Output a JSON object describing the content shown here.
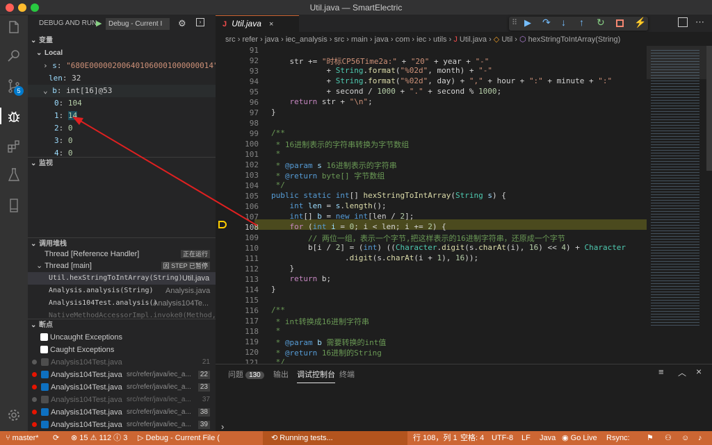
{
  "window": {
    "title": "Util.java — SmartElectric"
  },
  "debug_panel": {
    "title": "DEBUG AND RUN",
    "config": "Debug - Current I"
  },
  "variables": {
    "section": "变量",
    "scope": "Local",
    "items": [
      {
        "name": "s",
        "value": "\"680E000002006401060001000000014\""
      },
      {
        "name": "len",
        "value": "32"
      },
      {
        "name": "b",
        "value": "int[16]@53"
      }
    ],
    "array": [
      {
        "index": "0",
        "value": "104"
      },
      {
        "index": "1",
        "value": "14"
      },
      {
        "index": "2",
        "value": "0"
      },
      {
        "index": "3",
        "value": "0"
      },
      {
        "index": "4",
        "value": "0"
      }
    ]
  },
  "watch": {
    "section": "监视"
  },
  "callstack": {
    "section": "调用堆栈",
    "threads": [
      {
        "name": "Thread [Reference Handler]",
        "status": "正在运行"
      },
      {
        "name": "Thread [main]",
        "status": "因 STEP 已暂停"
      }
    ],
    "frames": [
      {
        "fn": "Util.hexStringToIntArray(String)",
        "file": "Util.java"
      },
      {
        "fn": "Analysis.analysis(String)",
        "file": "Analysis.java"
      },
      {
        "fn": "Analysis104Test.analysis()",
        "file": "Analysis104Te..."
      },
      {
        "fn": "NativeMethodAccessorImpl.invoke0(Method,Obje",
        "file": ""
      }
    ]
  },
  "breakpoints": {
    "section": "断点",
    "exceptions": [
      "Uncaught Exceptions",
      "Caught Exceptions"
    ],
    "items": [
      {
        "file": "Analysis104Test.java",
        "path": "",
        "line": "21",
        "enabled": false
      },
      {
        "file": "Analysis104Test.java",
        "path": "src/refer/java/iec_a...",
        "line": "22",
        "enabled": true
      },
      {
        "file": "Analysis104Test.java",
        "path": "src/refer/java/iec_a...",
        "line": "23",
        "enabled": true
      },
      {
        "file": "Analysis104Test.java",
        "path": "src/refer/java/iec_a...",
        "line": "37",
        "enabled": false
      },
      {
        "file": "Analysis104Test.java",
        "path": "src/refer/java/iec_a...",
        "line": "38",
        "enabled": true
      },
      {
        "file": "Analysis104Test.java",
        "path": "src/refer/java/iec_a...",
        "line": "39",
        "enabled": true
      }
    ]
  },
  "tab": {
    "label": "Util.java"
  },
  "breadcrumb": [
    "src",
    "refer",
    "java",
    "iec_analysis",
    "src",
    "main",
    "java",
    "com",
    "iec",
    "utils",
    "Util.java",
    "Util",
    "hexStringToIntArray(String)"
  ],
  "code_lines": [
    "91",
    "92",
    "93",
    "94",
    "95",
    "96",
    "97",
    "98",
    "99",
    "100",
    "101",
    "102",
    "103",
    "104",
    "105",
    "106",
    "107",
    "108",
    "109",
    "110",
    "111",
    "112",
    "113",
    "114",
    "115",
    "116",
    "117",
    "118",
    "119",
    "120",
    "121"
  ],
  "panel": {
    "tabs": [
      "问题",
      "输出",
      "调试控制台",
      "终端"
    ],
    "problem_count": "130",
    "prompt": "›"
  },
  "status": {
    "branch": "master*",
    "errors": "15",
    "warnings": "112",
    "info": "3",
    "debug": "Debug - Current File (",
    "running": "Running tests...",
    "position": "行 108，列 1",
    "spaces": "空格: 4",
    "encoding": "UTF-8",
    "eol": "LF",
    "language": "Java",
    "live": "Go Live",
    "rsync": "Rsync:"
  },
  "colors": {
    "status_bar": "#cc6633",
    "accent": "#007acc",
    "arrow": "#e02020",
    "highlight": "#4b4a1e"
  }
}
